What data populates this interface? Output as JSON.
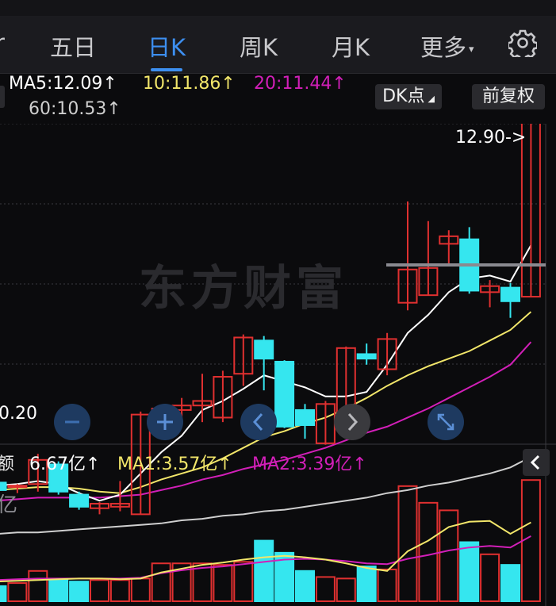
{
  "tabs": [
    {
      "label": "五日"
    },
    {
      "label": "日K"
    },
    {
      "label": "周K"
    },
    {
      "label": "月K"
    },
    {
      "label": "更多"
    }
  ],
  "active_tab": "日K",
  "ma": {
    "ma5": "MA5:12.09↑",
    "ma10": "10:11.86↑",
    "ma20": "20:11.44↑",
    "ma60": "60:10.53↑"
  },
  "buttons": {
    "dk": "DK点",
    "fq": "前复权"
  },
  "price_annotations": {
    "high": "12.90->",
    "low": "0.20"
  },
  "watermark": "东方财富",
  "volume": {
    "label_fragment": "额",
    "value": "6.67亿↑",
    "ma1": "MA1:3.57亿↑",
    "ma2": "MA2:3.39亿↑",
    "unit_fragment": "亿"
  },
  "colors": {
    "up": "#e03030",
    "down": "#35e6ef",
    "ma5": "#ffffff",
    "ma10": "#f2e66a",
    "ma20": "#d21fb8",
    "ma60": "#cfcfcf",
    "accent": "#3d8ff0"
  },
  "chart_data": [
    {
      "type": "candlestick",
      "candles": [
        {
          "o": 10.36,
          "c": 10.31,
          "h": 10.37,
          "l": 10.28
        },
        {
          "o": 10.33,
          "c": 10.34,
          "h": 10.35,
          "l": 10.29
        },
        {
          "o": 10.35,
          "c": 10.51,
          "h": 10.55,
          "l": 10.3
        },
        {
          "o": 10.48,
          "c": 10.3,
          "h": 10.5,
          "l": 10.28
        },
        {
          "o": 10.28,
          "c": 10.2,
          "h": 10.3,
          "l": 10.18
        },
        {
          "o": 10.19,
          "c": 10.22,
          "h": 10.23,
          "l": 10.15
        },
        {
          "o": 10.2,
          "c": 10.22,
          "h": 10.37,
          "l": 10.17
        },
        {
          "o": 10.15,
          "c": 10.81,
          "h": 10.83,
          "l": 10.15
        },
        {
          "o": 10.81,
          "c": 10.85,
          "h": 10.87,
          "l": 10.65
        },
        {
          "o": 10.84,
          "c": 10.87,
          "h": 10.92,
          "l": 10.77
        },
        {
          "o": 10.87,
          "c": 10.9,
          "h": 11.08,
          "l": 10.76
        },
        {
          "o": 10.79,
          "c": 11.06,
          "h": 11.1,
          "l": 10.76
        },
        {
          "o": 11.08,
          "c": 11.32,
          "h": 11.34,
          "l": 11.0
        },
        {
          "o": 11.3,
          "c": 11.18,
          "h": 11.33,
          "l": 10.97
        },
        {
          "o": 11.16,
          "c": 10.73,
          "h": 11.17,
          "l": 10.72
        },
        {
          "o": 10.84,
          "c": 10.74,
          "h": 10.88,
          "l": 10.65
        },
        {
          "o": 10.62,
          "c": 10.88,
          "h": 10.9,
          "l": 10.61
        },
        {
          "o": 10.82,
          "c": 11.25,
          "h": 11.26,
          "l": 10.79
        },
        {
          "o": 11.21,
          "c": 11.18,
          "h": 11.28,
          "l": 11.14
        },
        {
          "o": 11.11,
          "c": 11.31,
          "h": 11.35,
          "l": 11.07
        },
        {
          "o": 11.55,
          "c": 11.77,
          "h": 12.22,
          "l": 11.5
        },
        {
          "o": 11.6,
          "c": 11.78,
          "h": 12.09,
          "l": 11.6
        },
        {
          "o": 11.94,
          "c": 11.99,
          "h": 12.03,
          "l": 11.8
        },
        {
          "o": 11.97,
          "c": 11.63,
          "h": 12.05,
          "l": 11.61
        },
        {
          "o": 11.62,
          "c": 11.66,
          "h": 11.7,
          "l": 11.52
        },
        {
          "o": 11.65,
          "c": 11.56,
          "h": 11.68,
          "l": 11.45
        },
        {
          "o": 11.59,
          "c": 12.9,
          "h": 12.9,
          "l": 11.59
        }
      ],
      "ma5": [
        10.34,
        10.35,
        10.37,
        10.35,
        10.29,
        10.24,
        10.28,
        10.42,
        10.56,
        10.67,
        10.84,
        10.9,
        10.98,
        11.07,
        11.03,
        10.99,
        10.93,
        10.93,
        10.96,
        11.14,
        11.35,
        11.47,
        11.62,
        11.71,
        11.73,
        11.69,
        11.93
      ],
      "ma10": [
        10.31,
        10.32,
        10.33,
        10.33,
        10.32,
        10.3,
        10.29,
        10.33,
        10.38,
        10.42,
        10.46,
        10.52,
        10.59,
        10.66,
        10.7,
        10.75,
        10.79,
        10.85,
        10.92,
        11.0,
        11.07,
        11.13,
        11.18,
        11.23,
        11.3,
        11.37,
        11.49
      ],
      "ma20": [
        10.24,
        10.25,
        10.26,
        10.26,
        10.26,
        10.26,
        10.27,
        10.28,
        10.31,
        10.34,
        10.38,
        10.41,
        10.45,
        10.48,
        10.51,
        10.55,
        10.59,
        10.64,
        10.69,
        10.73,
        10.79,
        10.85,
        10.92,
        10.99,
        11.06,
        11.14,
        11.29
      ],
      "ma60": [
        10.02,
        10.03,
        10.03,
        10.04,
        10.05,
        10.06,
        10.07,
        10.08,
        10.09,
        10.11,
        10.12,
        10.14,
        10.15,
        10.17,
        10.18,
        10.2,
        10.22,
        10.24,
        10.26,
        10.29,
        10.31,
        10.34,
        10.36,
        10.39,
        10.42,
        10.46,
        10.53
      ]
    },
    {
      "type": "bar",
      "unit": "亿",
      "values": [
        1.0,
        1.2,
        2.0,
        1.4,
        1.3,
        1.4,
        1.4,
        1.5,
        2.5,
        2.5,
        2.5,
        2.4,
        2.6,
        4.0,
        3.2,
        2.0,
        1.6,
        1.5,
        2.3,
        2.1,
        7.6,
        6.5,
        6.0,
        3.9,
        3.1,
        2.4,
        8.0
      ],
      "ma1": [
        1.3,
        1.35,
        1.4,
        1.45,
        1.5,
        1.5,
        1.45,
        1.5,
        1.9,
        2.15,
        2.4,
        2.55,
        2.75,
        2.9,
        3.0,
        2.9,
        2.75,
        2.5,
        2.2,
        2.0,
        3.3,
        4.0,
        4.9,
        5.25,
        5.3,
        4.45,
        5.2
      ],
      "ma2": [
        1.4,
        1.45,
        1.5,
        1.5,
        1.5,
        1.5,
        1.5,
        1.55,
        1.85,
        2.05,
        2.2,
        2.3,
        2.45,
        2.6,
        2.75,
        2.8,
        2.75,
        2.65,
        2.5,
        2.45,
        2.8,
        3.05,
        3.35,
        3.55,
        3.65,
        3.55,
        4.3
      ],
      "ylim": [
        0,
        8.0
      ]
    }
  ]
}
